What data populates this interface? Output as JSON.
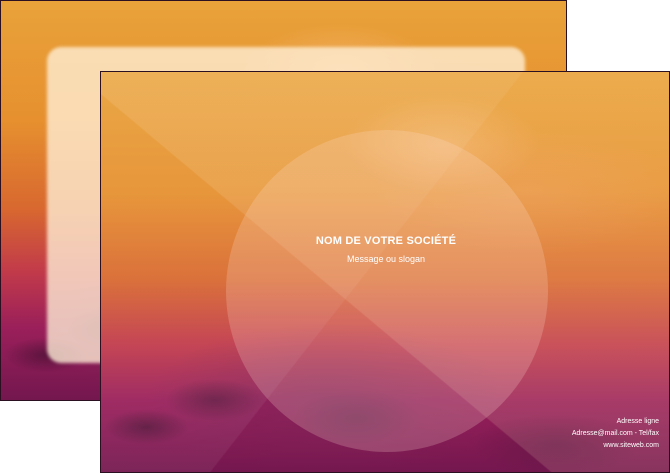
{
  "flyer": {
    "company_name": "NOM DE VOTRE SOCIÉTÉ",
    "slogan": "Message ou slogan",
    "address": "Adresse ligne",
    "email_phone": "Adresse@mail.com - Tel/fax",
    "website": "www.siteweb.com"
  },
  "colors": {
    "sky_top": "#e9a23a",
    "sky_middle": "#d8682f",
    "sky_bottom": "#74174f",
    "text": "#ffffff"
  }
}
